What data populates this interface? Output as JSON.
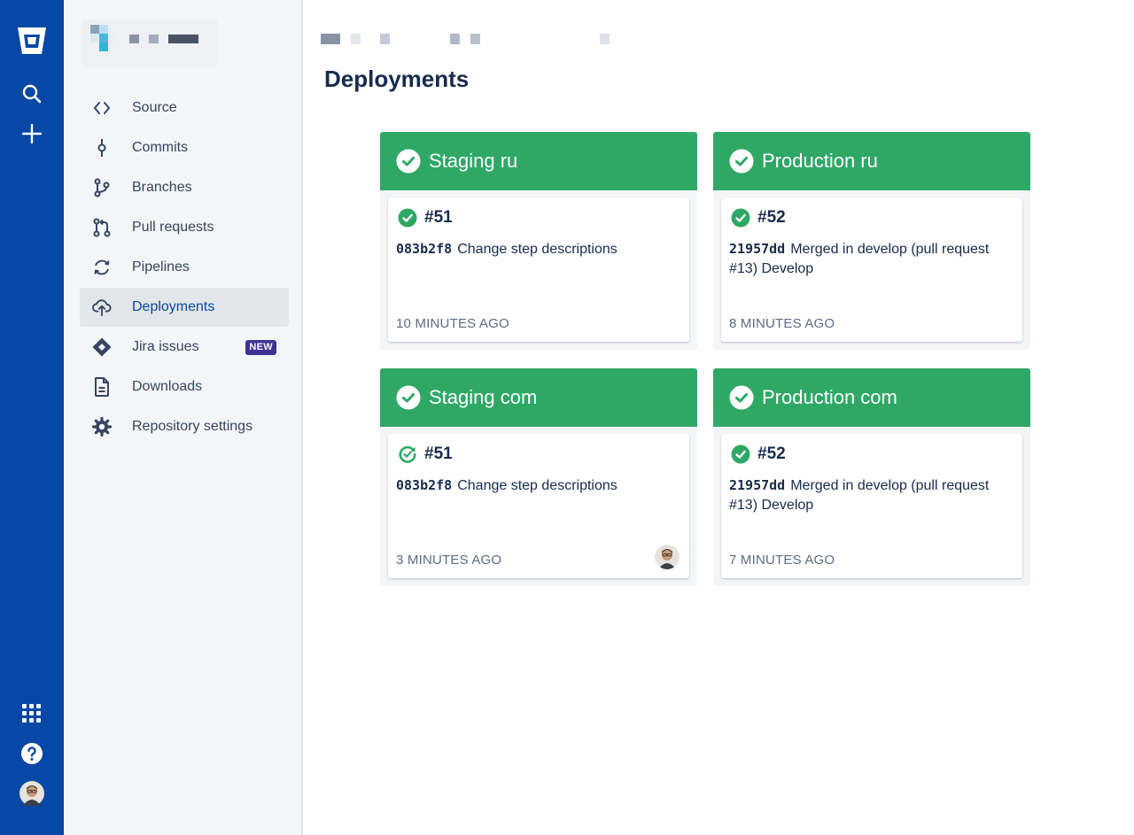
{
  "colors": {
    "global_nav": "#0747a6",
    "success": "#2fa866",
    "text_primary": "#172b4d",
    "text_subtle": "#5e6c84",
    "badge_new": "#403294"
  },
  "global_nav": {
    "icons": [
      "bitbucket-logo-icon",
      "search-icon",
      "plus-icon",
      "app-switcher-icon",
      "help-icon",
      "user-avatar"
    ]
  },
  "sidebar": {
    "items": [
      {
        "label": "Source",
        "icon": "code-icon"
      },
      {
        "label": "Commits",
        "icon": "commit-icon"
      },
      {
        "label": "Branches",
        "icon": "branch-icon"
      },
      {
        "label": "Pull requests",
        "icon": "pull-request-icon"
      },
      {
        "label": "Pipelines",
        "icon": "pipelines-icon"
      },
      {
        "label": "Deployments",
        "icon": "cloud-upload-icon",
        "active": true
      },
      {
        "label": "Jira issues",
        "icon": "jira-icon",
        "badge": "NEW"
      },
      {
        "label": "Downloads",
        "icon": "document-icon"
      },
      {
        "label": "Repository settings",
        "icon": "gear-icon"
      }
    ]
  },
  "main": {
    "title": "Deployments",
    "environments": [
      {
        "name": "Staging ru",
        "status": "success",
        "deploy": {
          "number": "#51",
          "status": "success",
          "hash": "083b2f8",
          "message": "Change step descriptions",
          "time": "10 MINUTES AGO"
        }
      },
      {
        "name": "Production ru",
        "status": "success",
        "deploy": {
          "number": "#52",
          "status": "success",
          "hash": "21957dd",
          "message": "Merged in develop (pull request #13) Develop",
          "time": "8 MINUTES AGO"
        }
      },
      {
        "name": "Staging com",
        "status": "success",
        "deploy": {
          "number": "#51",
          "status": "redeploying",
          "hash": "083b2f8",
          "message": "Change step descriptions",
          "time": "3 MINUTES AGO"
        }
      },
      {
        "name": "Production com",
        "status": "success",
        "deploy": {
          "number": "#52",
          "status": "success",
          "hash": "21957dd",
          "message": "Merged in develop (pull request #13) Develop",
          "time": "7 MINUTES AGO"
        }
      }
    ]
  }
}
